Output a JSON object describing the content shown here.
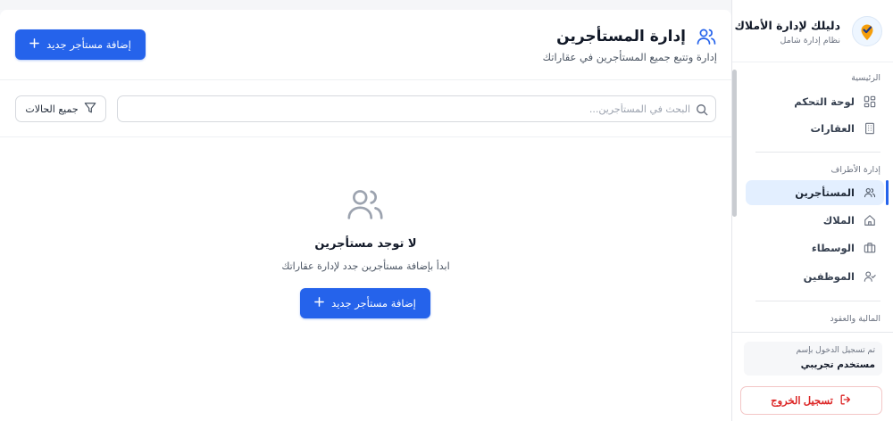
{
  "sidebar": {
    "brand": {
      "title": "دليلك لإدارة الأملاك",
      "subtitle": "نظام إدارة شامل"
    },
    "sections": [
      {
        "label": "الرئيسية"
      },
      {
        "label": "إدارة الأطراف"
      },
      {
        "label": "المالية والعقود"
      }
    ],
    "items": [
      {
        "label": "لوحة التحكم",
        "icon": "dashboard-icon",
        "active": false
      },
      {
        "label": "العقارات",
        "icon": "building-icon",
        "active": false
      },
      {
        "label": "المستأجرين",
        "icon": "users-icon",
        "active": true
      },
      {
        "label": "الملاك",
        "icon": "home-icon",
        "active": false
      },
      {
        "label": "الوسطاء",
        "icon": "briefcase-icon",
        "active": false
      },
      {
        "label": "الموظفين",
        "icon": "user-check-icon",
        "active": false
      }
    ],
    "user": {
      "label": "تم تسجيل الدخول بإسم",
      "name": "مستخدم تجريبي"
    },
    "logout_label": "تسجيل الخروج"
  },
  "header": {
    "title": "إدارة المستأجرين",
    "subtitle": "إدارة وتتبع جميع المستأجرين في عقاراتك",
    "add_button_label": "إضافة مستأجر جديد"
  },
  "filters": {
    "search_placeholder": "البحث في المستأجرين...",
    "search_value": "",
    "status_selected": "جميع الحالات"
  },
  "empty_state": {
    "title": "لا توجد مستأجرين",
    "subtitle": "ابدأ بإضافة مستأجرين جدد لإدارة عقاراتك",
    "button_label": "إضافة مستأجر جديد"
  },
  "colors": {
    "primary": "#2563eb",
    "active_bg": "#e3efff",
    "danger": "#dc2626"
  }
}
